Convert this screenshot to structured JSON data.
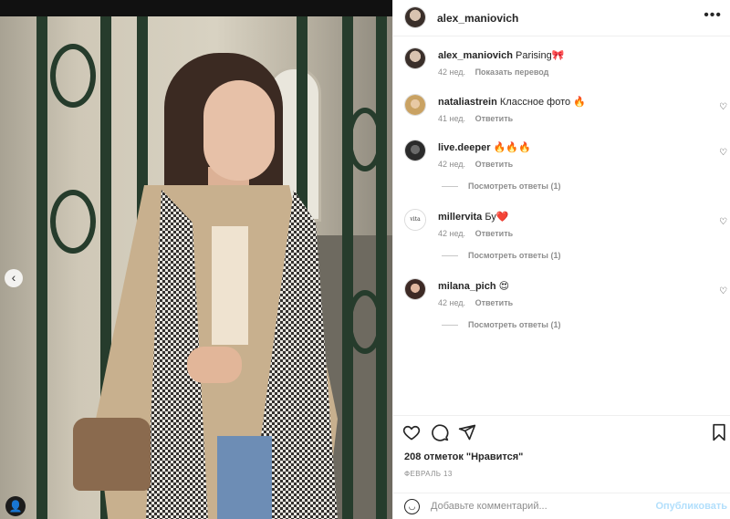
{
  "post": {
    "author": "alex_maniovich",
    "more_icon": "more-horizontal-icon",
    "caption": {
      "username": "alex_maniovich",
      "text": "Parising🎀",
      "age": "42 нед.",
      "translate": "Показать перевод"
    }
  },
  "comments": [
    {
      "username": "nataliastrein",
      "text": "Классное фото 🔥",
      "age": "41 нед.",
      "reply": "Ответить",
      "view_replies": ""
    },
    {
      "username": "live.deeper",
      "text": "🔥🔥🔥",
      "age": "42 нед.",
      "reply": "Ответить",
      "view_replies": "Посмотреть ответы (1)"
    },
    {
      "username": "millervita",
      "text": "Бу❤️",
      "age": "42 нед.",
      "reply": "Ответить",
      "view_replies": "Посмотреть ответы (1)"
    },
    {
      "username": "milana_pich",
      "text": "😍",
      "age": "42 нед.",
      "reply": "Ответить",
      "view_replies": "Посмотреть ответы (1)"
    }
  ],
  "actions": {
    "like_icon": "heart-icon",
    "comment_icon": "comment-icon",
    "share_icon": "send-icon",
    "save_icon": "bookmark-icon"
  },
  "likes": "208 отметок \"Нравится\"",
  "date": "ФЕВРАЛЬ 13",
  "add_comment": {
    "placeholder": "Добавьте комментарий...",
    "publish": "Опубликовать"
  },
  "colors": {
    "publish_disabled": "#b2dffc",
    "muted": "#8e8e8e",
    "text": "#262626"
  }
}
